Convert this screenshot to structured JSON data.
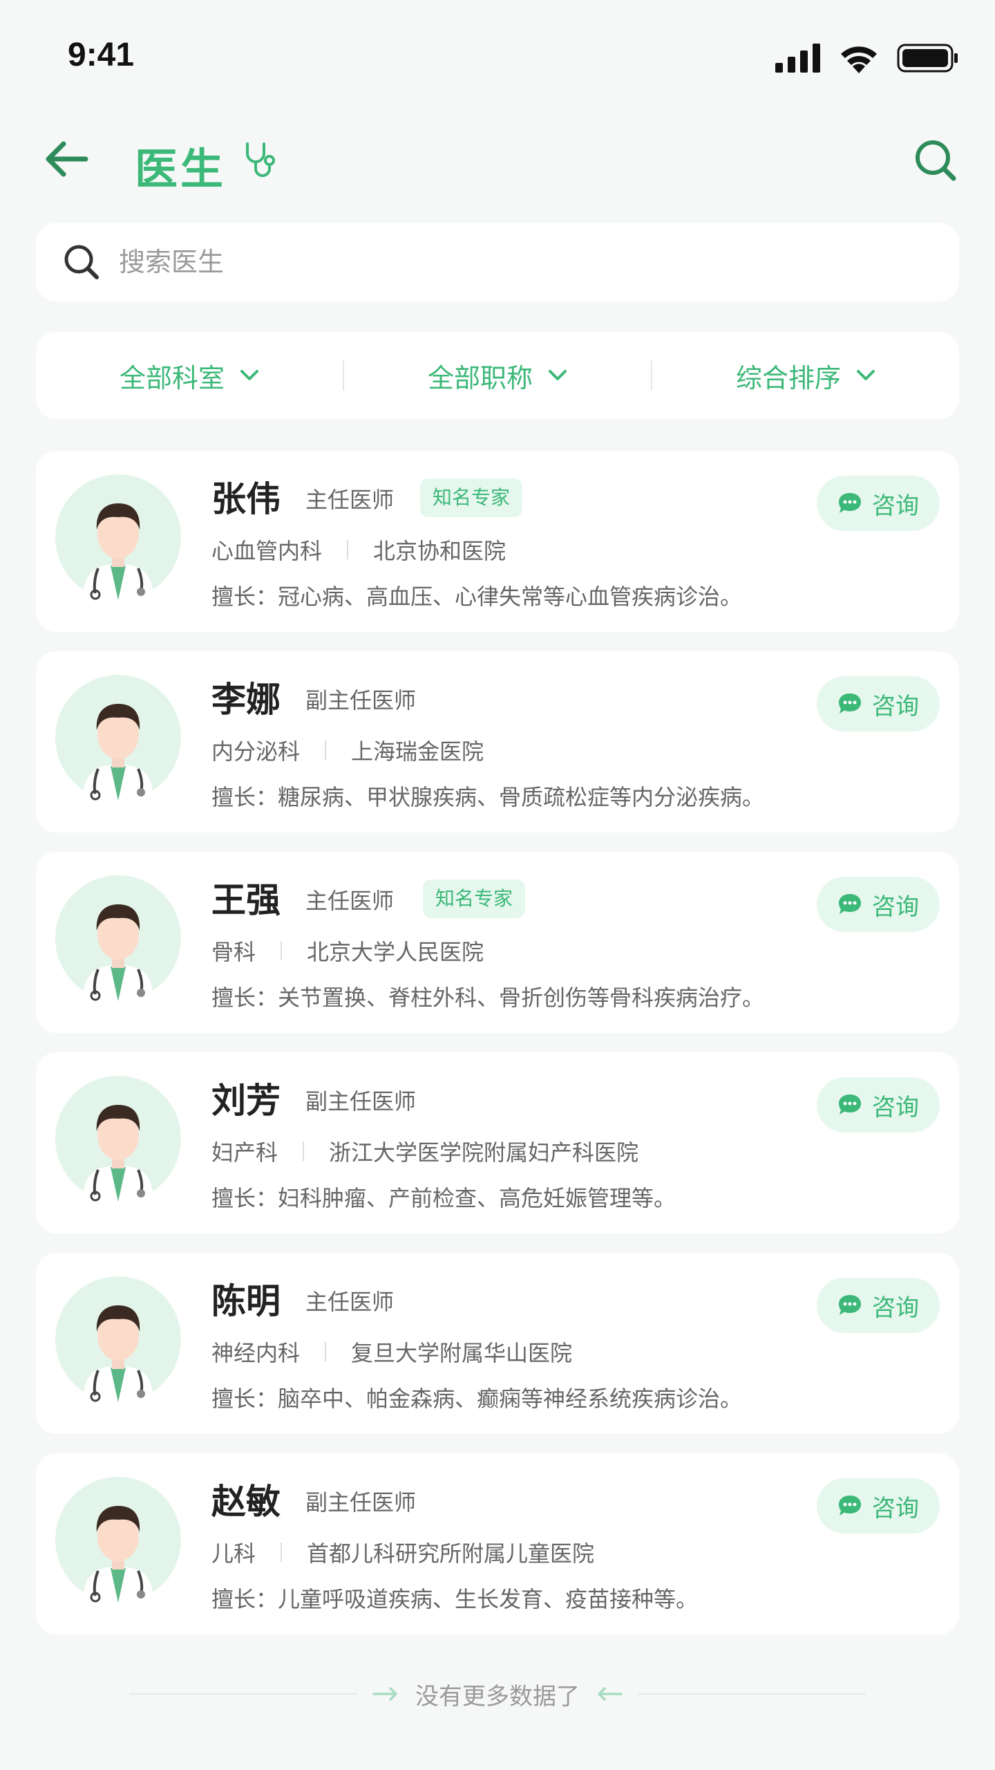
{
  "status_bar": {
    "time": "9:41"
  },
  "header": {
    "title": "医生"
  },
  "search": {
    "placeholder": "搜索医生"
  },
  "filters": [
    {
      "label": "全部科室"
    },
    {
      "label": "全部职称"
    },
    {
      "label": "综合排序"
    }
  ],
  "doctors": [
    {
      "name": "张伟",
      "title": "主任医师",
      "badge": "知名专家",
      "department": "心血管内科",
      "hospital": "北京协和医院",
      "expertise": "擅长：冠心病、高血压、心律失常等心血管疾病诊治。",
      "consult_label": "咨询"
    },
    {
      "name": "李娜",
      "title": "副主任医师",
      "badge": "",
      "department": "内分泌科",
      "hospital": "上海瑞金医院",
      "expertise": "擅长：糖尿病、甲状腺疾病、骨质疏松症等内分泌疾病。",
      "consult_label": "咨询"
    },
    {
      "name": "王强",
      "title": "主任医师",
      "badge": "知名专家",
      "department": "骨科",
      "hospital": "北京大学人民医院",
      "expertise": "擅长：关节置换、脊柱外科、骨折创伤等骨科疾病治疗。",
      "consult_label": "咨询"
    },
    {
      "name": "刘芳",
      "title": "副主任医师",
      "badge": "",
      "department": "妇产科",
      "hospital": "浙江大学医学院附属妇产科医院",
      "expertise": "擅长：妇科肿瘤、产前检查、高危妊娠管理等。",
      "consult_label": "咨询"
    },
    {
      "name": "陈明",
      "title": "主任医师",
      "badge": "",
      "department": "神经内科",
      "hospital": "复旦大学附属华山医院",
      "expertise": "擅长：脑卒中、帕金森病、癫痫等神经系统疾病诊治。",
      "consult_label": "咨询"
    },
    {
      "name": "赵敏",
      "title": "副主任医师",
      "badge": "",
      "department": "儿科",
      "hospital": "首都儿科研究所附属儿童医院",
      "expertise": "擅长：儿童呼吸道疾病、生长发育、疫苗接种等。",
      "consult_label": "咨询"
    }
  ],
  "footer": {
    "no_more_text": "没有更多数据了"
  },
  "colors": {
    "accent": "#3cb878",
    "accent_light": "#e6f7ee",
    "background": "#f6f8f7"
  }
}
